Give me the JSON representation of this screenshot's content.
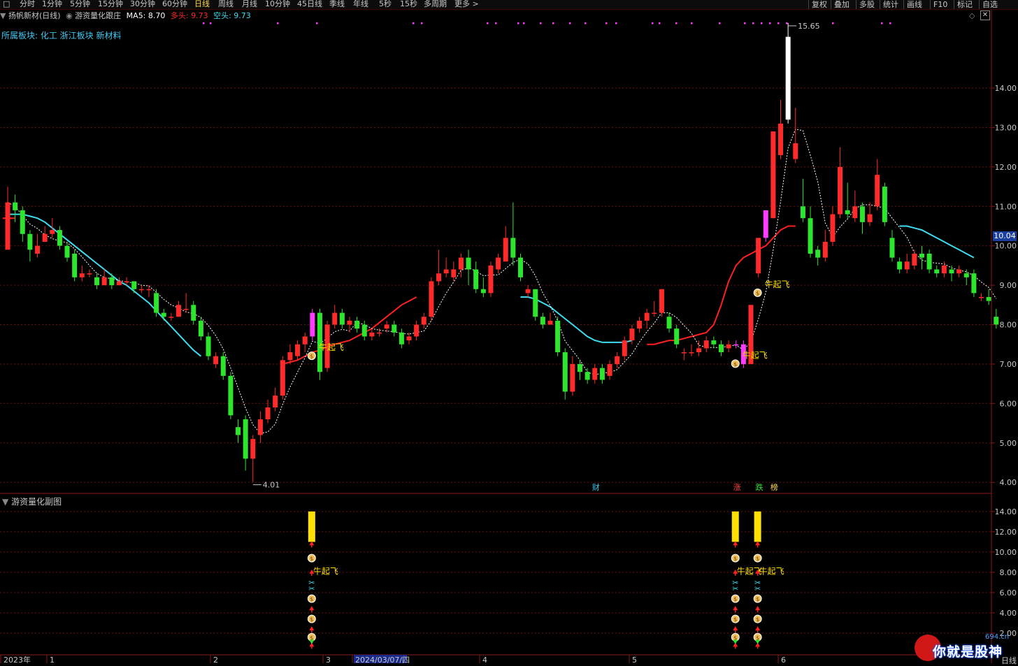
{
  "toolbar": {
    "periods": [
      "分时",
      "1分钟",
      "5分钟",
      "15分钟",
      "30分钟",
      "60分钟",
      "日线",
      "周线",
      "月线",
      "10分钟",
      "45日线",
      "季线",
      "年线",
      "5秒",
      "15秒",
      "多周期",
      "更多 >"
    ],
    "active_period": "日线",
    "right_buttons": [
      "复权",
      "叠加",
      "多股",
      "统计",
      "画线",
      "F10",
      "标记",
      "自选"
    ]
  },
  "legend": {
    "stock": "扬帆新材(日线)",
    "indicator": "游资量化跟庄",
    "ma5_label": "MA5: 8.70",
    "bull_label": "多头: 9.73",
    "bear_label": "空头: 9.73"
  },
  "sector": "所属板块: 化工 浙江板块 新材料",
  "sub_title": "游资量化副图",
  "current_price_tag": "10.04",
  "period_tag": "日线",
  "watermark": {
    "url": "694.cn",
    "text": "你就是股神"
  },
  "colors": {
    "up": "#ff2a2a",
    "down": "#2ee52e",
    "ma_long": "#3fdcf0",
    "ma_red": "#ff2020",
    "ma5": "#ffffff",
    "magenta": "#ff3cff",
    "signal": "#ffe000",
    "grid": "#6b1010"
  },
  "chart_data": {
    "type": "candlestick",
    "x_labels": [
      "2023年",
      "1",
      "2",
      "3",
      "2024/03/07/四",
      "4",
      "5",
      "6"
    ],
    "y_ticks": [
      4.0,
      5.0,
      6.0,
      7.0,
      8.0,
      9.0,
      10.0,
      11.0,
      12.0,
      13.0,
      14.0
    ],
    "ylim": [
      3.72,
      15.95
    ],
    "high_label": "15.65",
    "low_label": "4.01",
    "signal_text": "牛起飞",
    "event_markers": [
      {
        "text": "财",
        "after_bar": 79,
        "color": "#3ec8f0"
      },
      {
        "text": "涨",
        "after_bar": 98,
        "color": "#ff4040"
      },
      {
        "text": "跌",
        "after_bar": 101,
        "color": "#2ee52e"
      },
      {
        "text": "榜",
        "after_bar": 103,
        "color": "#ffd84a"
      }
    ],
    "candles": [
      [
        9.9,
        11.1,
        11.5,
        10.9
      ],
      [
        11.1,
        10.9,
        11.3,
        10.6
      ],
      [
        10.9,
        10.3,
        11.0,
        10.1
      ],
      [
        10.3,
        9.9,
        10.4,
        9.6
      ],
      [
        9.8,
        10.0,
        10.3,
        9.7
      ],
      [
        10.1,
        10.3,
        10.5,
        10.1
      ],
      [
        10.3,
        10.4,
        10.7,
        10.2
      ],
      [
        10.4,
        10.0,
        10.5,
        9.9
      ],
      [
        10.0,
        9.7,
        10.1,
        9.6
      ],
      [
        9.8,
        9.2,
        9.9,
        9.1
      ],
      [
        9.2,
        9.3,
        9.5,
        9.1
      ],
      [
        9.3,
        9.3,
        9.4,
        9.2
      ],
      [
        9.2,
        9.0,
        9.3,
        8.9
      ],
      [
        9.0,
        9.2,
        9.4,
        9.0
      ],
      [
        9.2,
        9.0,
        9.3,
        8.9
      ],
      [
        9.0,
        9.1,
        9.2,
        9.0
      ],
      [
        9.1,
        9.1,
        9.2,
        9.0
      ],
      [
        9.1,
        8.9,
        9.1,
        8.8
      ],
      [
        8.9,
        8.9,
        9.0,
        8.8
      ],
      [
        8.9,
        8.9,
        9.0,
        8.7
      ],
      [
        8.8,
        8.3,
        8.9,
        8.2
      ],
      [
        8.3,
        8.2,
        8.4,
        8.1
      ],
      [
        8.2,
        8.2,
        8.3,
        8.1
      ],
      [
        8.2,
        8.5,
        8.6,
        8.2
      ],
      [
        8.4,
        8.4,
        8.8,
        8.3
      ],
      [
        8.5,
        8.1,
        8.6,
        8.0
      ],
      [
        8.1,
        7.7,
        8.2,
        7.6
      ],
      [
        7.7,
        7.2,
        7.8,
        7.1
      ],
      [
        7.0,
        7.2,
        7.3,
        6.9
      ],
      [
        7.2,
        6.7,
        7.3,
        6.6
      ],
      [
        6.7,
        5.7,
        6.8,
        5.6
      ],
      [
        5.4,
        5.2,
        5.6,
        5.0
      ],
      [
        5.6,
        4.6,
        5.7,
        4.3
      ],
      [
        4.6,
        5.1,
        5.2,
        4.01
      ],
      [
        5.2,
        5.6,
        5.8,
        5.0
      ],
      [
        5.6,
        5.9,
        6.1,
        5.5
      ],
      [
        5.9,
        6.2,
        6.4,
        5.8
      ],
      [
        6.2,
        7.1,
        7.2,
        6.1
      ],
      [
        7.1,
        7.3,
        7.5,
        7.0
      ],
      [
        7.2,
        7.5,
        7.6,
        7.1
      ],
      [
        7.5,
        7.7,
        7.8,
        7.3
      ],
      [
        7.7,
        8.3,
        8.4,
        7.6
      ],
      [
        8.3,
        6.8,
        8.4,
        6.6
      ],
      [
        6.9,
        8.0,
        8.1,
        6.8
      ],
      [
        8.0,
        8.3,
        8.5,
        7.9
      ],
      [
        8.3,
        8.0,
        8.4,
        7.9
      ],
      [
        8.0,
        8.1,
        8.2,
        7.8
      ],
      [
        8.1,
        7.9,
        8.2,
        7.8
      ],
      [
        8.0,
        7.7,
        8.1,
        7.6
      ],
      [
        7.7,
        7.8,
        7.9,
        7.6
      ],
      [
        7.8,
        7.8,
        7.9,
        7.7
      ],
      [
        7.9,
        8.0,
        8.1,
        7.8
      ],
      [
        8.0,
        7.8,
        8.1,
        7.7
      ],
      [
        7.8,
        7.5,
        7.9,
        7.4
      ],
      [
        7.6,
        7.7,
        7.8,
        7.5
      ],
      [
        7.7,
        8.0,
        8.1,
        7.6
      ],
      [
        8.0,
        8.2,
        8.3,
        7.9
      ],
      [
        8.2,
        9.1,
        9.2,
        8.1
      ],
      [
        9.1,
        9.3,
        9.9,
        9.0
      ],
      [
        9.3,
        9.4,
        9.7,
        9.2
      ],
      [
        9.2,
        9.4,
        9.6,
        9.1
      ],
      [
        9.4,
        9.7,
        9.8,
        9.2
      ],
      [
        9.7,
        9.4,
        9.9,
        9.0
      ],
      [
        9.4,
        8.9,
        9.6,
        8.8
      ],
      [
        8.9,
        8.8,
        9.2,
        8.7
      ],
      [
        8.8,
        9.5,
        9.6,
        8.7
      ],
      [
        9.4,
        9.7,
        9.8,
        9.3
      ],
      [
        9.6,
        10.2,
        10.5,
        9.6
      ],
      [
        10.2,
        9.7,
        11.1,
        9.5
      ],
      [
        9.7,
        9.2,
        9.8,
        9.1
      ],
      [
        8.8,
        8.9,
        9.0,
        8.7
      ],
      [
        8.9,
        8.2,
        8.9,
        8.1
      ],
      [
        8.2,
        8.0,
        8.3,
        7.9
      ],
      [
        8.0,
        8.1,
        8.3,
        8.0
      ],
      [
        8.1,
        7.3,
        8.2,
        7.2
      ],
      [
        7.3,
        6.3,
        7.4,
        6.1
      ],
      [
        6.3,
        7.0,
        7.2,
        6.2
      ],
      [
        7.0,
        6.8,
        7.1,
        6.6
      ],
      [
        6.8,
        6.6,
        6.9,
        6.5
      ],
      [
        6.6,
        6.9,
        7.0,
        6.5
      ],
      [
        6.9,
        6.6,
        7.0,
        6.5
      ],
      [
        6.7,
        7.0,
        7.1,
        6.6
      ],
      [
        7.0,
        7.2,
        7.3,
        6.9
      ],
      [
        7.2,
        7.6,
        7.7,
        7.1
      ],
      [
        7.6,
        7.9,
        8.0,
        7.5
      ],
      [
        7.9,
        8.1,
        8.2,
        7.8
      ],
      [
        8.1,
        8.3,
        8.4,
        7.9
      ],
      [
        8.3,
        8.3,
        8.6,
        8.2
      ],
      [
        8.3,
        8.9,
        8.9,
        8.2
      ],
      [
        8.2,
        7.9,
        8.3,
        7.8
      ],
      [
        7.9,
        7.5,
        8.0,
        7.4
      ],
      [
        7.3,
        7.3,
        7.4,
        7.1
      ],
      [
        7.3,
        7.3,
        7.5,
        7.2
      ],
      [
        7.3,
        7.4,
        7.6,
        7.2
      ],
      [
        7.4,
        7.6,
        7.7,
        7.3
      ],
      [
        7.6,
        7.5,
        7.7,
        7.4
      ],
      [
        7.5,
        7.3,
        7.6,
        7.2
      ],
      [
        7.4,
        7.5,
        7.6,
        7.3
      ],
      [
        7.5,
        7.5,
        7.6,
        7.4
      ],
      [
        7.5,
        7.0,
        7.6,
        6.9
      ],
      [
        7.0,
        8.5,
        8.5,
        7.0
      ],
      [
        9.3,
        10.2,
        10.2,
        9.2
      ],
      [
        10.2,
        10.9,
        10.9,
        10.1
      ],
      [
        10.7,
        12.9,
        12.9,
        10.7
      ],
      [
        12.3,
        13.1,
        13.7,
        12.2
      ],
      [
        13.2,
        15.3,
        15.65,
        13.1
      ],
      [
        12.2,
        12.6,
        13.5,
        12.1
      ],
      [
        11.0,
        10.7,
        11.7,
        10.6
      ],
      [
        10.7,
        9.8,
        11.0,
        9.7
      ],
      [
        9.9,
        9.7,
        10.0,
        9.5
      ],
      [
        9.7,
        10.1,
        10.4,
        9.6
      ],
      [
        10.1,
        10.8,
        11.0,
        10.0
      ],
      [
        10.8,
        12.0,
        12.5,
        10.7
      ],
      [
        10.9,
        10.8,
        11.6,
        10.7
      ],
      [
        10.7,
        11.0,
        11.4,
        10.6
      ],
      [
        11.0,
        10.6,
        11.1,
        10.3
      ],
      [
        10.6,
        10.8,
        11.1,
        10.5
      ],
      [
        11.0,
        11.8,
        12.2,
        10.9
      ],
      [
        11.5,
        10.6,
        11.6,
        10.5
      ],
      [
        10.2,
        9.7,
        10.4,
        9.6
      ],
      [
        9.6,
        9.4,
        9.7,
        9.3
      ],
      [
        9.4,
        9.6,
        9.8,
        9.3
      ],
      [
        9.5,
        9.8,
        9.9,
        9.4
      ],
      [
        9.8,
        9.7,
        10.0,
        9.4
      ],
      [
        9.8,
        9.4,
        9.9,
        9.3
      ],
      [
        9.4,
        9.3,
        9.5,
        9.2
      ],
      [
        9.3,
        9.5,
        9.6,
        9.2
      ],
      [
        9.4,
        9.3,
        9.5,
        9.1
      ],
      [
        9.3,
        9.4,
        9.5,
        9.2
      ],
      [
        9.3,
        9.2,
        9.4,
        9.0
      ],
      [
        9.3,
        8.8,
        9.4,
        8.7
      ],
      [
        8.7,
        8.7,
        8.8,
        8.6
      ],
      [
        8.7,
        8.6,
        8.9,
        8.5
      ],
      [
        8.2,
        8.0,
        8.4,
        7.9
      ]
    ],
    "magenta_bars": [
      41,
      98,
      99,
      102
    ],
    "white_bar": 105,
    "signal_bars": [
      41,
      98,
      101
    ],
    "ma_long": [
      10.8,
      10.8,
      10.8,
      10.75,
      10.7,
      10.6,
      10.45,
      10.3,
      10.15,
      10.0,
      9.85,
      9.7,
      9.55,
      9.4,
      9.25,
      9.1,
      9.0,
      8.85,
      8.7,
      8.55,
      8.35,
      8.15,
      7.95,
      7.75,
      7.55,
      7.35,
      7.2
    ],
    "ma_long_start": 0,
    "ma_red": [
      7.0,
      7.05,
      7.1,
      7.2,
      7.3,
      7.35,
      7.45,
      7.5,
      7.55,
      7.6,
      7.7,
      7.8,
      7.9,
      8.05,
      8.2,
      8.35,
      8.5,
      8.6,
      8.7
    ],
    "ma_red_start": 37,
    "ma_cyan2": [
      8.7,
      8.7,
      8.65,
      8.55,
      8.45,
      8.3,
      8.15,
      8.0,
      7.85,
      7.7,
      7.6,
      7.55,
      7.55,
      7.55,
      7.55,
      7.6
    ],
    "ma_cyan2_start": 69,
    "ma_red2": [
      7.5,
      7.5,
      7.55,
      7.6,
      7.6,
      7.65,
      7.7,
      7.75,
      7.8,
      8.0,
      8.5,
      9.1,
      9.5,
      9.7,
      9.8,
      9.9,
      10.0,
      10.2,
      10.4,
      10.5,
      10.5
    ],
    "ma_red2_start": 86,
    "ma_cyan3": [
      10.5,
      10.5,
      10.45,
      10.4,
      10.3,
      10.2,
      10.1,
      10.0,
      9.9,
      9.8,
      9.7
    ],
    "ma_cyan3_start": 120,
    "sub_chart": {
      "y_ticks": [
        2.0,
        4.0,
        6.0,
        8.0,
        10.0,
        12.0,
        14.0
      ],
      "ylim": [
        0,
        15.3
      ],
      "signal_top": 14.0,
      "signal_bottom": 11.0
    }
  }
}
